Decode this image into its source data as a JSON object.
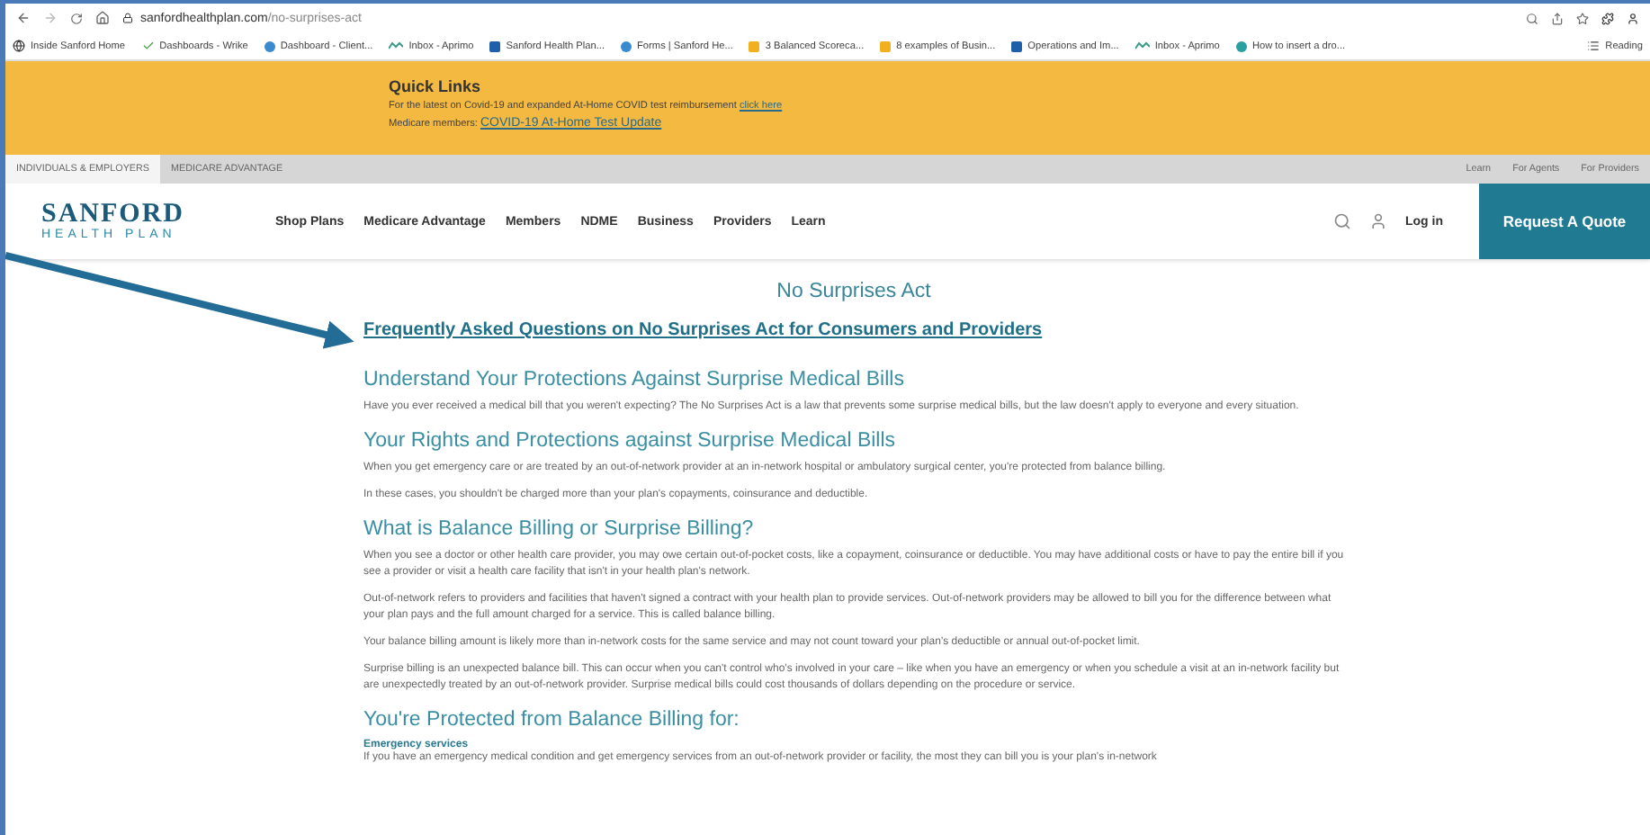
{
  "browser": {
    "url_domain": "sanfordhealthplan.com",
    "url_path": "/no-surprises-act",
    "bookmarks": [
      {
        "kind": "globe",
        "label": "Inside Sanford Home"
      },
      {
        "kind": "check",
        "label": "Dashboards - Wrike"
      },
      {
        "kind": "app",
        "label": "Dashboard - Client..."
      },
      {
        "kind": "wave",
        "label": "Inbox - Aprimo"
      },
      {
        "kind": "square",
        "label": "Sanford Health Plan..."
      },
      {
        "kind": "app",
        "label": "Forms | Sanford He..."
      },
      {
        "kind": "doc",
        "label": "3 Balanced Scoreca..."
      },
      {
        "kind": "doc",
        "label": "8 examples of Busin..."
      },
      {
        "kind": "square",
        "label": "Operations and Im..."
      },
      {
        "kind": "wave",
        "label": "Inbox - Aprimo"
      },
      {
        "kind": "circle",
        "label": "How to insert a dro..."
      }
    ],
    "reading_list": "Reading"
  },
  "quick_links": {
    "title": "Quick Links",
    "lines": [
      {
        "text": "For the latest on Covid-19 and expanded At-Home COVID test reimbursement ",
        "link": "click here"
      },
      {
        "text": "Medicare members: ",
        "link": "COVID-19 At-Home Test Update"
      }
    ]
  },
  "audience_tabs": [
    {
      "label": "INDIVIDUALS & EMPLOYERS",
      "selected": true
    },
    {
      "label": "MEDICARE ADVANTAGE",
      "selected": false
    }
  ],
  "utility_links": [
    "Learn",
    "For Agents",
    "For Providers"
  ],
  "nav": {
    "logo_top": "SANFORD",
    "logo_bottom": "HEALTH PLAN",
    "items": [
      "Shop Plans",
      "Medicare Advantage",
      "Members",
      "NDME",
      "Business",
      "Providers",
      "Learn"
    ],
    "login": "Log in",
    "cta": "Request A Quote"
  },
  "content": {
    "title": "No Surprises Act",
    "faq_link": "Frequently Asked Questions on No Surprises Act for Consumers and Providers",
    "sections": [
      {
        "heading": "Understand Your Protections Against Surprise Medical Bills",
        "paragraphs": [
          "Have you ever received a medical bill that you weren't expecting? The No Surprises Act is a law that prevents some surprise medical bills, but the law doesn't apply to everyone and every situation."
        ]
      },
      {
        "heading": "Your Rights and Protections against Surprise Medical Bills",
        "paragraphs": [
          "When you get emergency care or are treated by an out-of-network provider at an in-network hospital or ambulatory surgical center, you're protected from balance billing.",
          "In these cases, you shouldn't be charged more than your plan's copayments, coinsurance and deductible."
        ]
      },
      {
        "heading": "What is Balance Billing or Surprise Billing?",
        "paragraphs": [
          "When you see a doctor or other health care provider, you may owe certain out-of-pocket costs, like a copayment, coinsurance or deductible. You may have additional costs or have to pay the entire bill if you see a provider or visit a health care facility that isn't in your health plan's network.",
          "Out-of-network refers to providers and facilities that haven't signed a contract with your health plan to provide services. Out-of-network providers may be allowed to bill you for the difference between what your plan pays and the full amount charged for a service. This is called balance billing.",
          "Your balance billing amount is likely more than in-network costs for the same service and may not count toward your plan's deductible or annual out-of-pocket limit.",
          "Surprise billing is an unexpected balance bill. This can occur when you can't control who's involved in your care – like when you have an emergency or when you schedule a visit at an in-network facility but are unexpectedly treated by an out-of-network provider. Surprise medical bills could cost thousands of dollars depending on the procedure or service."
        ]
      },
      {
        "heading": "You're Protected from Balance Billing for:"
      }
    ],
    "subheading": "Emergency services",
    "last_paragraph": "If you have an emergency medical condition and get emergency services from an out-of-network provider or facility, the most they can bill you is your plan's in-network"
  }
}
